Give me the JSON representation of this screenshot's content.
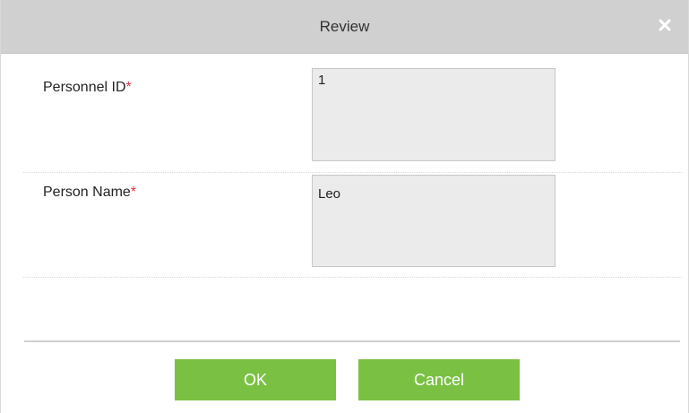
{
  "dialog": {
    "title": "Review",
    "close_icon": "close-icon"
  },
  "fields": [
    {
      "label": "Personnel ID",
      "required_mark": "*",
      "value": "1"
    },
    {
      "label": "Person Name",
      "required_mark": "*",
      "value": "Leo"
    }
  ],
  "buttons": {
    "ok_label": "OK",
    "cancel_label": "Cancel"
  },
  "colors": {
    "accent": "#7ac143",
    "required": "#e0303a",
    "titlebar": "#d0d0d0",
    "field_background": "#ebebeb"
  }
}
